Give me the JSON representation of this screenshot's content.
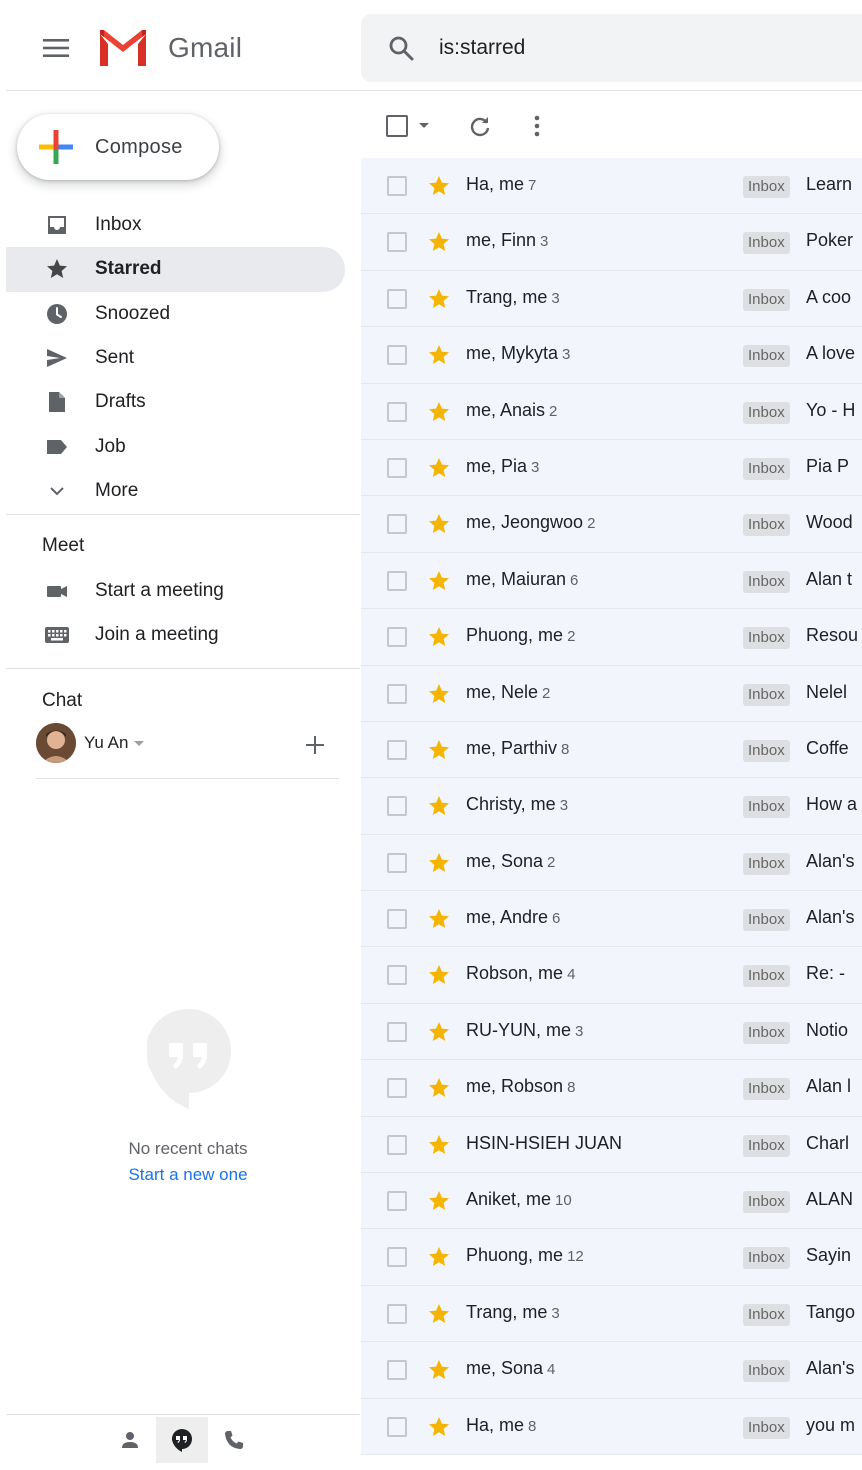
{
  "app": {
    "name": "Gmail"
  },
  "search": {
    "value": "is:starred"
  },
  "compose": {
    "label": "Compose"
  },
  "nav": [
    {
      "label": "Inbox",
      "icon": "inbox-icon",
      "active": false
    },
    {
      "label": "Starred",
      "icon": "star-icon",
      "active": true
    },
    {
      "label": "Snoozed",
      "icon": "clock-icon",
      "active": false
    },
    {
      "label": "Sent",
      "icon": "send-icon",
      "active": false
    },
    {
      "label": "Drafts",
      "icon": "draft-icon",
      "active": false
    },
    {
      "label": "Job",
      "icon": "label-icon",
      "active": false
    },
    {
      "label": "More",
      "icon": "chevron-down-icon",
      "active": false
    }
  ],
  "meet": {
    "title": "Meet",
    "start": "Start a meeting",
    "join": "Join a meeting"
  },
  "chat": {
    "title": "Chat",
    "user": "Yu An",
    "empty": "No recent chats",
    "new_chat": "Start a new one"
  },
  "colors": {
    "star": "#f4b400",
    "active_nav": "#e8eaed",
    "link": "#1a73e8",
    "row_bg": "#f2f6fc"
  },
  "emails": [
    {
      "sender": "Ha, me",
      "count": "7",
      "label": "Inbox",
      "subject": "Learn"
    },
    {
      "sender": "me, Finn",
      "count": "3",
      "label": "Inbox",
      "subject": "Poker"
    },
    {
      "sender": "Trang, me",
      "count": "3",
      "label": "Inbox",
      "subject": "A coo"
    },
    {
      "sender": "me, Mykyta",
      "count": "3",
      "label": "Inbox",
      "subject": "A love"
    },
    {
      "sender": "me, Anais",
      "count": "2",
      "label": "Inbox",
      "subject": "Yo - H"
    },
    {
      "sender": "me, Pia",
      "count": "3",
      "label": "Inbox",
      "subject": "Pia P"
    },
    {
      "sender": "me, Jeongwoo",
      "count": "2",
      "label": "Inbox",
      "subject": "Wood"
    },
    {
      "sender": "me, Maiuran",
      "count": "6",
      "label": "Inbox",
      "subject": "Alan t"
    },
    {
      "sender": "Phuong, me",
      "count": "2",
      "label": "Inbox",
      "subject": "Resou"
    },
    {
      "sender": "me, Nele",
      "count": "2",
      "label": "Inbox",
      "subject": "Nelel"
    },
    {
      "sender": "me, Parthiv",
      "count": "8",
      "label": "Inbox",
      "subject": "Coffe"
    },
    {
      "sender": "Christy, me",
      "count": "3",
      "label": "Inbox",
      "subject": "How a"
    },
    {
      "sender": "me, Sona",
      "count": "2",
      "label": "Inbox",
      "subject": "Alan's"
    },
    {
      "sender": "me, Andre",
      "count": "6",
      "label": "Inbox",
      "subject": "Alan's"
    },
    {
      "sender": "Robson, me",
      "count": "4",
      "label": "Inbox",
      "subject": "Re: -"
    },
    {
      "sender": "RU-YUN, me",
      "count": "3",
      "label": "Inbox",
      "subject": "Notio"
    },
    {
      "sender": "me, Robson",
      "count": "8",
      "label": "Inbox",
      "subject": "Alan l"
    },
    {
      "sender": "HSIN-HSIEH JUAN",
      "count": "",
      "label": "Inbox",
      "subject": "Charl"
    },
    {
      "sender": "Aniket, me",
      "count": "10",
      "label": "Inbox",
      "subject": "ALAN"
    },
    {
      "sender": "Phuong, me",
      "count": "12",
      "label": "Inbox",
      "subject": "Sayin"
    },
    {
      "sender": "Trang, me",
      "count": "3",
      "label": "Inbox",
      "subject": "Tango"
    },
    {
      "sender": "me, Sona",
      "count": "4",
      "label": "Inbox",
      "subject": "Alan's"
    },
    {
      "sender": "Ha, me",
      "count": "8",
      "label": "Inbox",
      "subject": "you m"
    }
  ]
}
